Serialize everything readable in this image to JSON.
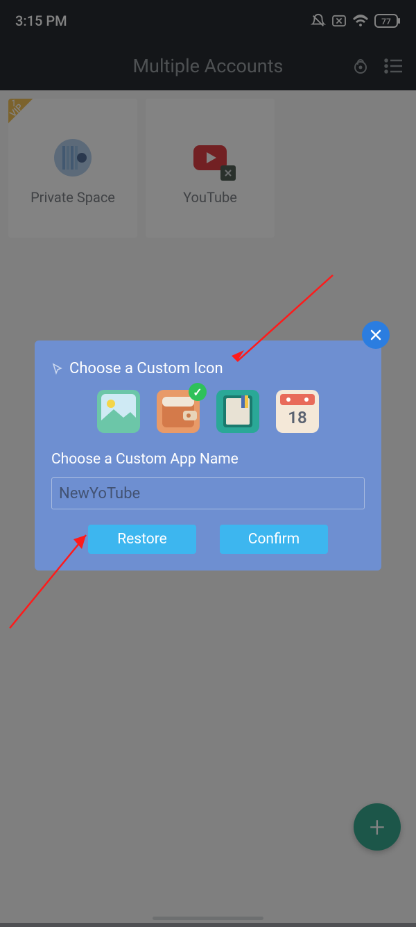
{
  "status": {
    "time": "3:15 PM",
    "battery": "77"
  },
  "header": {
    "title": "Multiple Accounts"
  },
  "tiles": [
    {
      "label": "Private Space"
    },
    {
      "label": "YouTube"
    }
  ],
  "vip": {
    "badge": "VIP",
    "num": "1"
  },
  "dialog": {
    "title": "Choose a Custom Icon",
    "subtitle": "Choose a Custom App Name",
    "input_value": "NewYoTube",
    "restore": "Restore",
    "confirm": "Confirm",
    "calendar_num": "18"
  },
  "fab": {
    "glyph": "+"
  }
}
